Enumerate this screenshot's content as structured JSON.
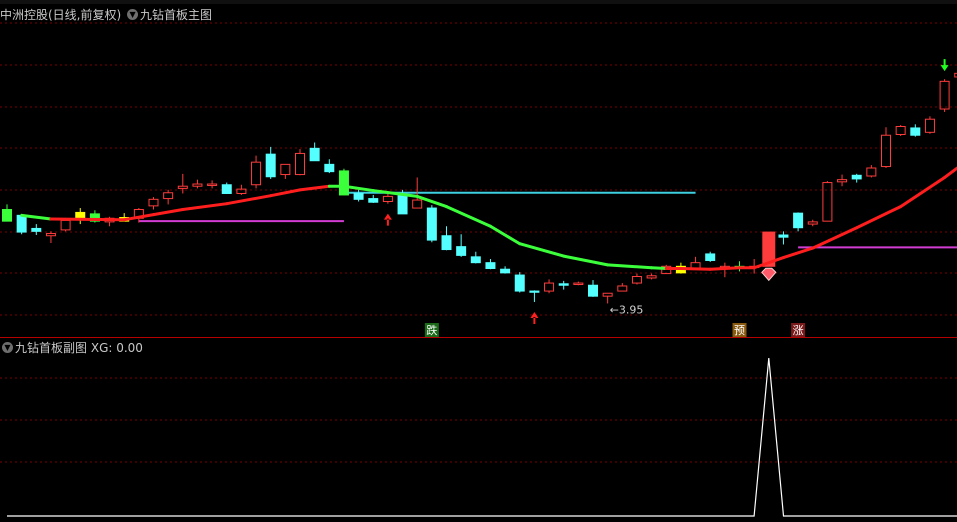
{
  "main_panel": {
    "stock_title": "中洲控股(日线,前复权)",
    "indicator_title": "九钻首板主图"
  },
  "sub_panel": {
    "indicator_title": "九钻首板副图",
    "xg_label": "XG: 0.00"
  },
  "colors": {
    "background": "#000000",
    "grid": "#7a0000",
    "up_candle": "#ff3c3c",
    "down_candle": "#54ffff",
    "signal_box": "#ffff00",
    "ma_up": "#ff1e1e",
    "ma_down": "#3cff3c",
    "level_cyan": "#3ecfe0",
    "level_magenta": "#d23cd2",
    "arrow_up": "#ff2020",
    "arrow_down": "#20ff20",
    "xg_line": "#ffffff"
  },
  "chart_data": [
    {
      "type": "candlestick",
      "title": "九钻首板主图",
      "candles": [
        {
          "o": 0.78,
          "h": 0.85,
          "l": 0.62,
          "c": 0.62,
          "s": "sig_green"
        },
        {
          "o": 0.7,
          "h": 0.72,
          "l": 0.44,
          "c": 0.47,
          "s": "down"
        },
        {
          "o": 0.52,
          "h": 0.58,
          "l": 0.43,
          "c": 0.48,
          "s": "down"
        },
        {
          "o": 0.42,
          "h": 0.48,
          "l": 0.32,
          "c": 0.45,
          "s": "up"
        },
        {
          "o": 0.5,
          "h": 0.66,
          "l": 0.48,
          "c": 0.63,
          "s": "up"
        },
        {
          "o": 0.67,
          "h": 0.8,
          "l": 0.58,
          "c": 0.74,
          "s": "sig_yellow"
        },
        {
          "o": 0.72,
          "h": 0.77,
          "l": 0.6,
          "c": 0.62,
          "s": "sig_green"
        },
        {
          "o": 0.61,
          "h": 0.68,
          "l": 0.55,
          "c": 0.66,
          "s": "up"
        },
        {
          "o": 0.67,
          "h": 0.73,
          "l": 0.62,
          "c": 0.62,
          "s": "sig_yellow"
        },
        {
          "o": 0.66,
          "h": 0.8,
          "l": 0.6,
          "c": 0.78,
          "s": "up"
        },
        {
          "o": 0.83,
          "h": 0.95,
          "l": 0.78,
          "c": 0.92,
          "s": "up"
        },
        {
          "o": 0.93,
          "h": 1.05,
          "l": 0.85,
          "c": 1.01,
          "s": "up"
        },
        {
          "o": 1.07,
          "h": 1.27,
          "l": 1.0,
          "c": 1.1,
          "s": "up"
        },
        {
          "o": 1.1,
          "h": 1.19,
          "l": 1.07,
          "c": 1.13,
          "s": "up"
        },
        {
          "o": 1.13,
          "h": 1.18,
          "l": 1.07,
          "c": 1.11,
          "s": "up"
        },
        {
          "o": 1.12,
          "h": 1.15,
          "l": 1.0,
          "c": 1.0,
          "s": "down"
        },
        {
          "o": 1.0,
          "h": 1.12,
          "l": 0.98,
          "c": 1.06,
          "s": "up"
        },
        {
          "o": 1.12,
          "h": 1.52,
          "l": 1.07,
          "c": 1.43,
          "s": "up"
        },
        {
          "o": 1.54,
          "h": 1.64,
          "l": 1.2,
          "c": 1.23,
          "s": "down"
        },
        {
          "o": 1.26,
          "h": 1.4,
          "l": 1.2,
          "c": 1.4,
          "s": "up"
        },
        {
          "o": 1.26,
          "h": 1.61,
          "l": 1.25,
          "c": 1.55,
          "s": "up"
        },
        {
          "o": 1.62,
          "h": 1.7,
          "l": 1.45,
          "c": 1.45,
          "s": "down"
        },
        {
          "o": 1.4,
          "h": 1.47,
          "l": 1.28,
          "c": 1.3,
          "s": "down"
        },
        {
          "o": 1.31,
          "h": 1.34,
          "l": 0.98,
          "c": 0.98,
          "s": "sig_green"
        },
        {
          "o": 1.0,
          "h": 1.05,
          "l": 0.89,
          "c": 0.92,
          "s": "down"
        },
        {
          "o": 0.93,
          "h": 0.98,
          "l": 0.87,
          "c": 0.88,
          "s": "down"
        },
        {
          "o": 0.89,
          "h": 1.0,
          "l": 0.86,
          "c": 0.96,
          "s": "up"
        },
        {
          "o": 0.97,
          "h": 1.05,
          "l": 0.72,
          "c": 0.72,
          "s": "down"
        },
        {
          "o": 0.8,
          "h": 1.22,
          "l": 0.8,
          "c": 0.91,
          "s": "up"
        },
        {
          "o": 0.8,
          "h": 0.84,
          "l": 0.33,
          "c": 0.36,
          "s": "down"
        },
        {
          "o": 0.42,
          "h": 0.55,
          "l": 0.22,
          "c": 0.23,
          "s": "down"
        },
        {
          "o": 0.27,
          "h": 0.44,
          "l": 0.13,
          "c": 0.15,
          "s": "down"
        },
        {
          "o": 0.13,
          "h": 0.2,
          "l": 0.04,
          "c": 0.05,
          "s": "down"
        },
        {
          "o": 0.05,
          "h": 0.1,
          "l": -0.04,
          "c": -0.03,
          "s": "down"
        },
        {
          "o": -0.04,
          "h": 0.0,
          "l": -0.1,
          "c": -0.09,
          "s": "down"
        },
        {
          "o": -0.12,
          "h": -0.08,
          "l": -0.36,
          "c": -0.34,
          "s": "down"
        },
        {
          "o": -0.34,
          "h": -0.33,
          "l": -0.49,
          "c": -0.34,
          "s": "down"
        },
        {
          "o": -0.34,
          "h": -0.18,
          "l": -0.37,
          "c": -0.23,
          "s": "up"
        },
        {
          "o": -0.26,
          "h": -0.2,
          "l": -0.32,
          "c": -0.24,
          "s": "down"
        },
        {
          "o": -0.23,
          "h": -0.21,
          "l": -0.26,
          "c": -0.25,
          "s": "up"
        },
        {
          "o": -0.26,
          "h": -0.19,
          "l": -0.42,
          "c": -0.41,
          "s": "down"
        },
        {
          "o": -0.41,
          "h": -0.37,
          "l": -0.51,
          "c": -0.37,
          "s": "up"
        },
        {
          "o": -0.34,
          "h": -0.23,
          "l": -0.34,
          "c": -0.27,
          "s": "up"
        },
        {
          "o": -0.23,
          "h": -0.1,
          "l": -0.25,
          "c": -0.14,
          "s": "up"
        },
        {
          "o": -0.16,
          "h": -0.1,
          "l": -0.18,
          "c": -0.13,
          "s": "up"
        },
        {
          "o": -0.1,
          "h": 0.02,
          "l": -0.1,
          "c": 0.0,
          "s": "up"
        },
        {
          "o": 0.0,
          "h": 0.05,
          "l": -0.1,
          "c": -0.09,
          "s": "sig_yellow"
        },
        {
          "o": -0.03,
          "h": 0.13,
          "l": -0.03,
          "c": 0.05,
          "s": "up"
        },
        {
          "o": 0.08,
          "h": 0.2,
          "l": 0.06,
          "c": 0.17,
          "s": "down"
        },
        {
          "o": 0.0,
          "h": 0.05,
          "l": -0.15,
          "c": 0.0,
          "s": "up"
        },
        {
          "o": 0.0,
          "h": 0.07,
          "l": -0.07,
          "c": 0.0,
          "s": "sig_green"
        },
        {
          "o": 0.0,
          "h": 0.1,
          "l": -0.1,
          "c": 0.0,
          "s": "up"
        },
        {
          "o": 0.0,
          "h": 0.47,
          "l": 0.0,
          "c": 0.47,
          "s": "limit"
        },
        {
          "o": 0.43,
          "h": 0.48,
          "l": 0.3,
          "c": 0.4,
          "s": "down"
        },
        {
          "o": 0.53,
          "h": 0.74,
          "l": 0.48,
          "c": 0.73,
          "s": "down"
        },
        {
          "o": 0.58,
          "h": 0.64,
          "l": 0.55,
          "c": 0.61,
          "s": "up"
        },
        {
          "o": 0.62,
          "h": 1.17,
          "l": 0.62,
          "c": 1.15,
          "s": "up"
        },
        {
          "o": 1.16,
          "h": 1.26,
          "l": 1.1,
          "c": 1.19,
          "s": "up"
        },
        {
          "o": 1.2,
          "h": 1.27,
          "l": 1.15,
          "c": 1.25,
          "s": "down"
        },
        {
          "o": 1.24,
          "h": 1.39,
          "l": 1.22,
          "c": 1.35,
          "s": "up"
        },
        {
          "o": 1.37,
          "h": 1.91,
          "l": 1.35,
          "c": 1.8,
          "s": "up"
        },
        {
          "o": 1.81,
          "h": 1.94,
          "l": 1.79,
          "c": 1.92,
          "s": "up"
        },
        {
          "o": 1.9,
          "h": 1.95,
          "l": 1.78,
          "c": 1.8,
          "s": "down"
        },
        {
          "o": 1.84,
          "h": 2.06,
          "l": 1.82,
          "c": 2.02,
          "s": "up"
        },
        {
          "o": 2.16,
          "h": 2.57,
          "l": 2.12,
          "c": 2.54,
          "s": "up"
        },
        {
          "o": 2.6,
          "h": 2.67,
          "l": 2.42,
          "c": 2.65,
          "s": "up"
        },
        {
          "o": 2.68,
          "h": 3.11,
          "l": 2.52,
          "c": 3.0,
          "s": "up"
        },
        {
          "o": 3.12,
          "h": 3.21,
          "l": 2.67,
          "c": 2.87,
          "s": "down"
        },
        {
          "o": 2.95,
          "h": 3.16,
          "l": 2.79,
          "c": 2.79,
          "s": "up"
        }
      ],
      "ma_line": [
        {
          "i": 1,
          "v": 0.7,
          "c": "green"
        },
        {
          "i": 3,
          "v": 0.65,
          "c": "green"
        },
        {
          "i": 8,
          "v": 0.64,
          "c": "red"
        },
        {
          "i": 10,
          "v": 0.71,
          "c": "red"
        },
        {
          "i": 12,
          "v": 0.78,
          "c": "red"
        },
        {
          "i": 15,
          "v": 0.86,
          "c": "red"
        },
        {
          "i": 18,
          "v": 0.97,
          "c": "red"
        },
        {
          "i": 20,
          "v": 1.05,
          "c": "red"
        },
        {
          "i": 22,
          "v": 1.1,
          "c": "red"
        },
        {
          "i": 23,
          "v": 1.1,
          "c": "green"
        },
        {
          "i": 25,
          "v": 1.04,
          "c": "green"
        },
        {
          "i": 28,
          "v": 0.96,
          "c": "green"
        },
        {
          "i": 30,
          "v": 0.82,
          "c": "green"
        },
        {
          "i": 33,
          "v": 0.55,
          "c": "green"
        },
        {
          "i": 35,
          "v": 0.31,
          "c": "green"
        },
        {
          "i": 38,
          "v": 0.14,
          "c": "green"
        },
        {
          "i": 41,
          "v": 0.02,
          "c": "green"
        },
        {
          "i": 44,
          "v": -0.02,
          "c": "green"
        },
        {
          "i": 45,
          "v": -0.03,
          "c": "green"
        },
        {
          "i": 46,
          "v": -0.03,
          "c": "red"
        },
        {
          "i": 48,
          "v": -0.04,
          "c": "red"
        },
        {
          "i": 50,
          "v": -0.02,
          "c": "red"
        },
        {
          "i": 51,
          "v": -0.02,
          "c": "red"
        },
        {
          "i": 53,
          "v": 0.12,
          "c": "red"
        },
        {
          "i": 55,
          "v": 0.25,
          "c": "red"
        },
        {
          "i": 58,
          "v": 0.53,
          "c": "red"
        },
        {
          "i": 61,
          "v": 0.82,
          "c": "red"
        },
        {
          "i": 64,
          "v": 1.22,
          "c": "red"
        },
        {
          "i": 66,
          "v": 1.52,
          "c": "red"
        },
        {
          "i": 68,
          "v": 1.86,
          "c": "red"
        }
      ],
      "level_lines": [
        {
          "color": "cyan",
          "v": 1.01,
          "from": 23,
          "to": 47
        },
        {
          "color": "magenta",
          "v": 0.62,
          "from": 9,
          "to": 23
        },
        {
          "color": "magenta",
          "v": 0.26,
          "from": 54,
          "to": 69
        }
      ],
      "arrows": [
        {
          "dir": "up",
          "color": "red",
          "i": 26
        },
        {
          "dir": "up",
          "color": "red",
          "i": 36
        },
        {
          "dir": "down",
          "color": "green",
          "i": 64
        }
      ],
      "price_note": {
        "i": 41,
        "text": "←3.95"
      },
      "signal_labels": [
        {
          "i": 29,
          "text": "跌",
          "bg": "#1a6a1a",
          "fg": "#ffffff"
        },
        {
          "i": 50,
          "text": "预",
          "bg": "#8a5a10",
          "fg": "#ffffff"
        },
        {
          "i": 54,
          "text": "涨",
          "bg": "#7a1a1a",
          "fg": "#ffffff"
        }
      ],
      "diamond_marker": {
        "i": 52
      }
    },
    {
      "type": "line",
      "title": "九钻首板副图",
      "series": [
        {
          "name": "XG",
          "values": [
            0,
            0,
            0,
            0,
            0,
            0,
            0,
            0,
            0,
            0,
            0,
            0,
            0,
            0,
            0,
            0,
            0,
            0,
            0,
            0,
            0,
            0,
            0,
            0,
            0,
            0,
            0,
            0,
            0,
            0,
            0,
            0,
            0,
            0,
            0,
            0,
            0,
            0,
            0,
            0,
            0,
            0,
            0,
            0,
            0,
            0,
            0,
            0,
            0,
            0,
            0,
            0,
            1,
            0,
            0,
            0,
            0,
            0,
            0,
            0,
            0,
            0,
            0,
            0,
            0,
            0,
            0,
            0,
            0
          ]
        }
      ]
    }
  ]
}
